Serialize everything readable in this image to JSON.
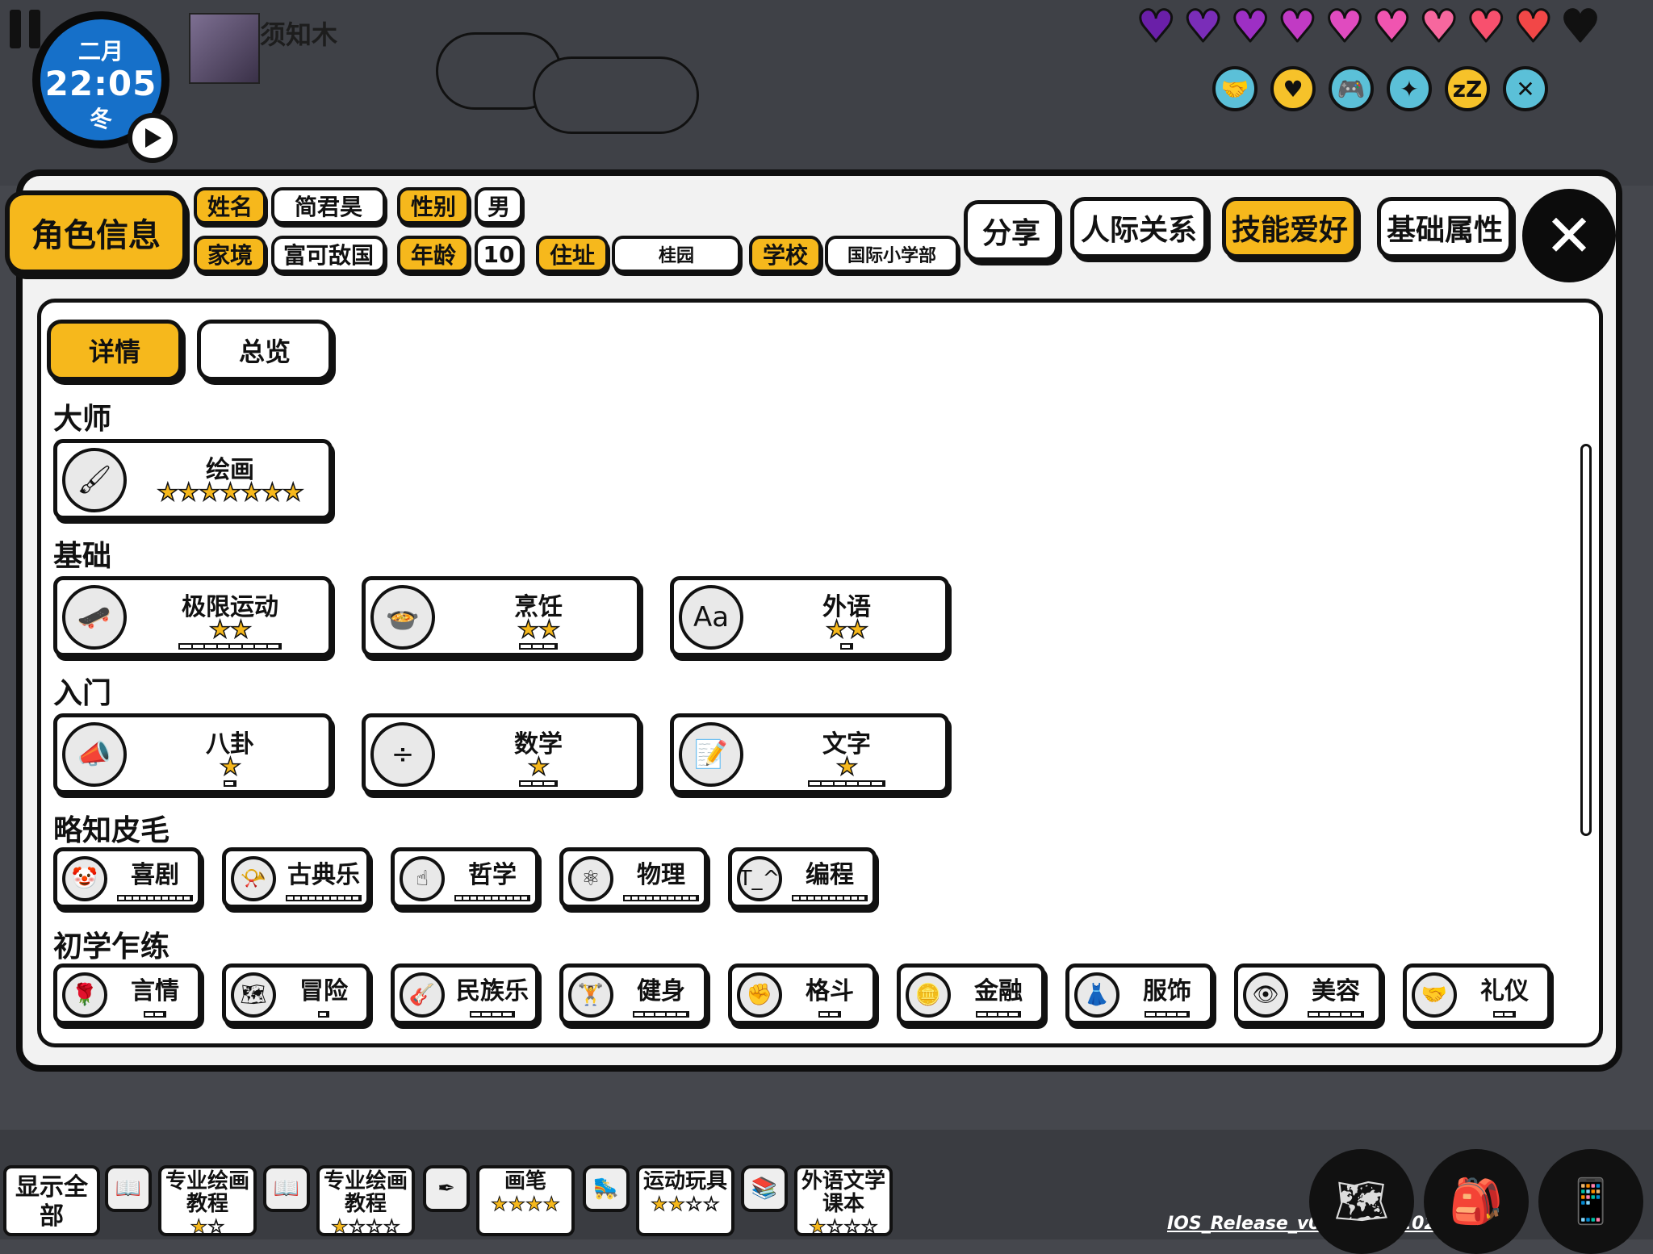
{
  "hud": {
    "month": "二月",
    "time": "22:05",
    "season": "冬",
    "player_name": "须知木",
    "hearts": [
      {
        "color": "#6a1fa8"
      },
      {
        "color": "#7a2db8"
      },
      {
        "color": "#9d2fc4"
      },
      {
        "color": "#c13ac4"
      },
      {
        "color": "#e04bbf"
      },
      {
        "color": "#f054b0"
      },
      {
        "color": "#f7679e"
      },
      {
        "color": "#f8506e"
      },
      {
        "color": "#f24747"
      },
      {
        "color": "#111111"
      }
    ],
    "status_icons": [
      {
        "name": "handshake-icon",
        "glyph": "🤝",
        "color": "#5bc0d8"
      },
      {
        "name": "heart-icon",
        "glyph": "♥",
        "color": "#f6c22a"
      },
      {
        "name": "gamepad-icon",
        "glyph": "🎮",
        "color": "#5bc0d8"
      },
      {
        "name": "sparkle-icon",
        "glyph": "✦",
        "color": "#5bc0d8"
      },
      {
        "name": "sleep-icon",
        "glyph": "zZ",
        "color": "#f6c22a"
      },
      {
        "name": "utensils-icon",
        "glyph": "✕",
        "color": "#5bc0d8"
      }
    ]
  },
  "header": {
    "title": "角色信息",
    "name_label": "姓名",
    "name_value": "简君昊",
    "gender_label": "性别",
    "gender_value": "男",
    "family_label": "家境",
    "family_value": "富可敌国",
    "age_label": "年龄",
    "age_value": "10",
    "address_label": "住址",
    "address_value": "桂园",
    "school_label": "学校",
    "school_value": "国际小学部",
    "share": "分享",
    "tabs": [
      "人际关系",
      "技能爱好",
      "基础属性"
    ],
    "active_tab": "技能爱好",
    "close": "✕"
  },
  "subtabs": [
    "详情",
    "总览"
  ],
  "sections": [
    {
      "title": "大师",
      "skills": [
        {
          "name": "绘画",
          "stars": 7,
          "icon": "paint-brush-icon",
          "glyph": "🖌",
          "bar_total": 0,
          "bar_filled": 0
        }
      ]
    },
    {
      "title": "基础",
      "skills": [
        {
          "name": "极限运动",
          "stars": 2,
          "icon": "skateboard-icon",
          "glyph": "🛹",
          "bar_total": 8,
          "bar_filled": 0
        },
        {
          "name": "烹饪",
          "stars": 2,
          "icon": "cooking-pot-icon",
          "glyph": "🍲",
          "bar_total": 3,
          "bar_filled": 0
        },
        {
          "name": "外语",
          "stars": 2,
          "icon": "foreign-language-icon",
          "glyph": "Aa",
          "bar_total": 1,
          "bar_filled": 0
        }
      ]
    },
    {
      "title": "入门",
      "skills": [
        {
          "name": "八卦",
          "stars": 1,
          "icon": "megaphone-icon",
          "glyph": "📣",
          "bar_total": 1,
          "bar_filled": 0
        },
        {
          "name": "数学",
          "stars": 1,
          "icon": "math-icon",
          "glyph": "÷",
          "bar_total": 3,
          "bar_filled": 0
        },
        {
          "name": "文字",
          "stars": 1,
          "icon": "writing-icon",
          "glyph": "📝",
          "bar_total": 6,
          "bar_filled": 0
        }
      ]
    },
    {
      "title": "略知皮毛",
      "skills": [
        {
          "name": "喜剧",
          "icon": "clown-icon",
          "glyph": "🤡",
          "bar_total": 10,
          "bar_filled": 0
        },
        {
          "name": "古典乐",
          "icon": "gramophone-icon",
          "glyph": "📯",
          "bar_total": 10,
          "bar_filled": 0
        },
        {
          "name": "哲学",
          "icon": "philosophy-icon",
          "glyph": "☝",
          "bar_total": 10,
          "bar_filled": 0
        },
        {
          "name": "物理",
          "icon": "atom-icon",
          "glyph": "⚛",
          "bar_total": 10,
          "bar_filled": 0
        },
        {
          "name": "编程",
          "icon": "code-face-icon",
          "glyph": "T_^",
          "bar_total": 10,
          "bar_filled": 0
        }
      ]
    },
    {
      "title": "初学乍练",
      "skills": [
        {
          "name": "言情",
          "icon": "rose-icon",
          "glyph": "🌹",
          "bar_total": 2,
          "bar_filled": 0
        },
        {
          "name": "冒险",
          "icon": "map-icon",
          "glyph": "🗺",
          "bar_total": 1,
          "bar_filled": 0
        },
        {
          "name": "民族乐",
          "icon": "guitar-icon",
          "glyph": "🎸",
          "bar_total": 4,
          "bar_filled": 0
        },
        {
          "name": "健身",
          "icon": "dumbbell-icon",
          "glyph": "🏋",
          "bar_total": 5,
          "bar_filled": 0
        },
        {
          "name": "格斗",
          "icon": "fist-icon",
          "glyph": "✊",
          "bar_total": 2,
          "bar_filled": 0
        },
        {
          "name": "金融",
          "icon": "coins-icon",
          "glyph": "🪙",
          "bar_total": 4,
          "bar_filled": 0
        },
        {
          "name": "服饰",
          "icon": "clothing-icon",
          "glyph": "👗",
          "bar_total": 4,
          "bar_filled": 0
        },
        {
          "name": "美容",
          "icon": "eye-makeup-icon",
          "glyph": "👁",
          "bar_total": 5,
          "bar_filled": 0
        },
        {
          "name": "礼仪",
          "icon": "handshake-icon",
          "glyph": "🤝",
          "bar_total": 2,
          "bar_filled": 0
        }
      ]
    }
  ],
  "bottom": {
    "show_all": "显示全部",
    "items": [
      {
        "label": "专业绘画教程",
        "stars": 1,
        "max": 2,
        "icon": "book-icon",
        "glyph": "📖"
      },
      {
        "label": "专业绘画教程",
        "stars": 1,
        "max": 4,
        "icon": "book-icon",
        "glyph": "📖"
      },
      {
        "label": "画笔",
        "stars": 4,
        "max": 4,
        "icon": "pen-icon",
        "glyph": "✒"
      },
      {
        "label": "运动玩具",
        "stars": 2,
        "max": 4,
        "icon": "roller-skate-icon",
        "glyph": "🛼"
      },
      {
        "label": "外语文学课本",
        "stars": 1,
        "max": 4,
        "icon": "textbook-icon",
        "glyph": "📚"
      }
    ],
    "version": "IOS_Release_v0.8.20.9_20210331",
    "round_buttons": [
      {
        "name": "map-icon",
        "glyph": "🗺"
      },
      {
        "name": "backpack-icon",
        "glyph": "🎒"
      },
      {
        "name": "phone-icon",
        "glyph": "📱"
      }
    ]
  }
}
